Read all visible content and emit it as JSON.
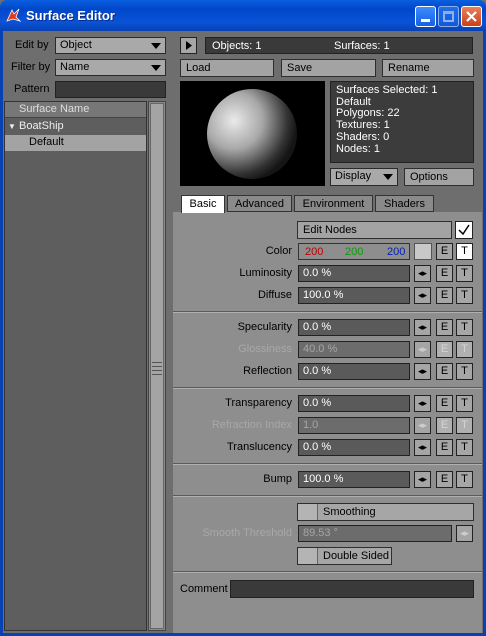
{
  "window": {
    "title": "Surface Editor"
  },
  "left": {
    "edit_by_label": "Edit by",
    "edit_by_value": "Object",
    "filter_by_label": "Filter by",
    "filter_by_value": "Name",
    "pattern_label": "Pattern",
    "list_header": "Surface Name",
    "tree": [
      {
        "label": "BoatShip",
        "expanded": true
      },
      {
        "label": "Default",
        "selected": true
      }
    ]
  },
  "top": {
    "objects": "Objects: 1",
    "surfaces": "Surfaces: 1",
    "load": "Load",
    "save": "Save",
    "rename": "Rename",
    "info": [
      "Surfaces Selected: 1",
      "Default",
      "Polygons: 22",
      "Textures: 1",
      "Shaders: 0",
      "Nodes: 1"
    ],
    "display": "Display",
    "options": "Options"
  },
  "tabs": [
    "Basic",
    "Advanced",
    "Environment",
    "Shaders"
  ],
  "basic": {
    "edit_nodes": "Edit Nodes",
    "color_label": "Color",
    "color_r": "200",
    "color_g": "200",
    "color_b": "200",
    "rows": [
      {
        "label": "Luminosity",
        "value": "0.0 %"
      },
      {
        "label": "Diffuse",
        "value": "100.0 %"
      },
      {
        "label": "Specularity",
        "value": "0.0 %"
      },
      {
        "label": "Glossiness",
        "value": "40.0 %",
        "disabled": true
      },
      {
        "label": "Reflection",
        "value": "0.0 %"
      },
      {
        "label": "Transparency",
        "value": "0.0 %"
      },
      {
        "label": "Refraction Index",
        "value": "1.0",
        "disabled": true
      },
      {
        "label": "Translucency",
        "value": "0.0 %"
      },
      {
        "label": "Bump",
        "value": "100.0 %"
      }
    ],
    "e": "E",
    "t": "T",
    "smoothing": "Smoothing",
    "smooth_threshold_label": "Smooth Threshold",
    "smooth_threshold_value": "89.53 °",
    "double_sided": "Double Sided",
    "comment_label": "Comment"
  },
  "colors": {
    "titlebar": "#0a53d8",
    "red": "#c00000",
    "green": "#00a000",
    "blue": "#0020c0"
  }
}
